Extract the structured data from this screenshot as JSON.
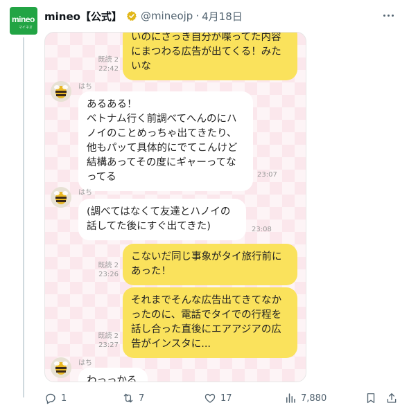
{
  "post": {
    "display_name": "mineo【公式】",
    "handle": "@mineojp",
    "separator": "·",
    "date": "4月18日",
    "avatar_logo": "mineo",
    "avatar_sub": "マイネオ"
  },
  "chat": {
    "messages": [
      {
        "side": "me",
        "text": "いのにさっき自分が喋ってた内容\nにまつわる広告が出てくる！みた\nいな",
        "read": "既読 2",
        "time": "22:42"
      },
      {
        "side": "them",
        "sender": "はち",
        "text": "あるある！\nベトナム行く前調べてへんのにハ\nノイのことめっちゃ出てきたり、\n他もパッて具体的にでてこんけど\n結構あってその度にギャーってな\nってる",
        "time": "23:07"
      },
      {
        "side": "them",
        "sender": "はち",
        "text": "(調べてはなくて友達とハノイの\n話してた後にすぐ出てきた)",
        "time": "23:08"
      },
      {
        "side": "me",
        "text": "こないだ同じ事象がタイ旅行前に\nあった！",
        "read": "既読 2",
        "time": "23:26"
      },
      {
        "side": "me",
        "text": "それまでそんな広告出てきてなか\nったのに、電話でタイでの行程を\n話し合った直後にエアアジアの広\n告がインスタに...",
        "read": "既読 2",
        "time": "23:27"
      },
      {
        "side": "them",
        "sender": "はち",
        "text": "わっっかる"
      }
    ]
  },
  "actions": {
    "replies": "1",
    "reposts": "7",
    "likes": "17",
    "views": "7,880"
  },
  "icons": {
    "reply": "reply-icon",
    "repost": "repost-icon",
    "like": "heart-icon",
    "views": "views-icon",
    "bookmark": "bookmark-icon",
    "share": "share-icon",
    "more": "more-icon",
    "verified": "verified-badge-icon"
  },
  "colors": {
    "brand_green": "#22a444",
    "verified_gold": "#e2b719",
    "my_bubble": "#fae25c",
    "chat_background": "#fbe7ec",
    "muted_text": "#536471"
  }
}
